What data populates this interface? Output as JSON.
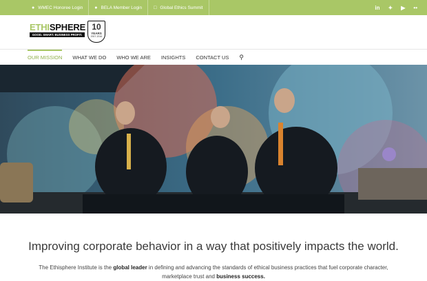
{
  "topbar": {
    "links": [
      {
        "icon": "user-icon",
        "label": "WMEC Honoree Login"
      },
      {
        "icon": "user-icon",
        "label": "BELA Member Login"
      },
      {
        "icon": "calendar-icon",
        "label": "Global Ethics Summit"
      }
    ],
    "social": [
      "linkedin-icon",
      "twitter-icon",
      "youtube-icon",
      "flickr-icon"
    ],
    "color": "#a9c766"
  },
  "logo": {
    "word_a": "ETHI",
    "word_b": "SPHERE",
    "tagline": "GOOD. SMART. BUSINESS PROFIT.",
    "badge_number": "10",
    "badge_text": "YEARS",
    "badge_years": "2007-2016"
  },
  "nav": {
    "items": [
      "OUR MISSION",
      "WHAT WE DO",
      "WHO WE ARE",
      "INSIGHTS",
      "CONTACT US"
    ],
    "active": "OUR MISSION"
  },
  "hero": {
    "alt": "Three men in suits seated on stage shaking hands"
  },
  "content": {
    "headline": "Improving corporate behavior in a way that positively impacts the world.",
    "p1": "The Ethisphere Institute is the ",
    "b1": "global leader",
    "p2": " in defining and advancing the standards of ethical business practices that fuel corporate character, marketplace trust and ",
    "b2": "business success."
  }
}
